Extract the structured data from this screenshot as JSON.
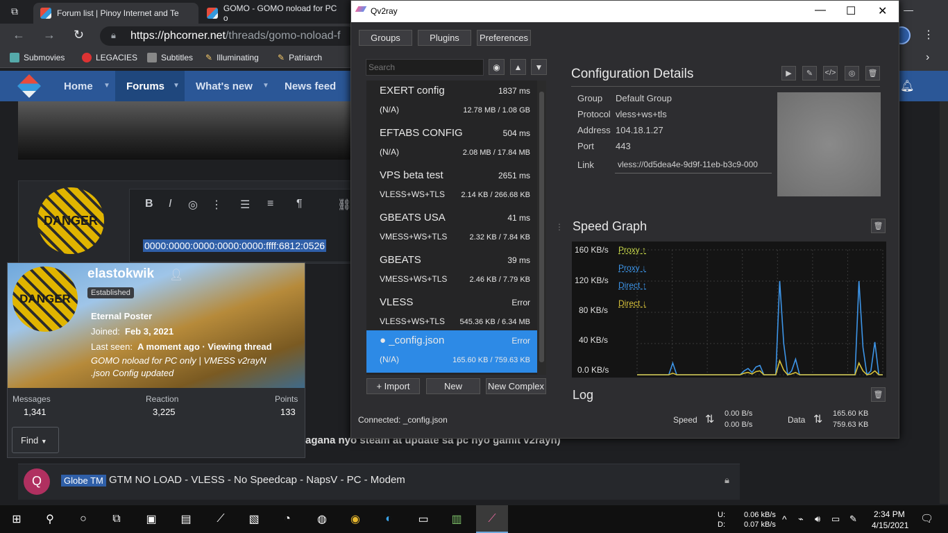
{
  "browser": {
    "tabs": [
      {
        "label": "Forum list | Pinoy Internet and Te"
      },
      {
        "label": "GOMO - GOMO noload for PC o"
      }
    ],
    "url_host": "https://phcorner.net",
    "url_path": "/threads/gomo-noload-f",
    "bookmarks": [
      "Submovies",
      "LEGACIES",
      "Subtitles",
      "Illuminating",
      "Patriarch"
    ]
  },
  "forum": {
    "nav": [
      "Home",
      "Forums",
      "What's new",
      "News feed"
    ],
    "highlighted_text": "0000:0000:0000:0000:0000:ffff:6812:0526",
    "card": {
      "username": "elastokwik",
      "badge": "Established",
      "rank": "Eternal Poster",
      "joined_label": "Joined:",
      "joined_value": "Feb 3, 2021",
      "seen_label": "Last seen:",
      "seen_value": "A moment ago · Viewing thread",
      "viewing_line1": "GOMO noload for PC only | VMESS v2rayN",
      "viewing_line2": ".json Config updated",
      "avatar_text": "DANGER",
      "stats": [
        {
          "label": "Messages",
          "value": "1,341"
        },
        {
          "label": "Reaction",
          "value": "3,225"
        },
        {
          "label": "Points",
          "value": "133"
        }
      ],
      "find": "Find"
    },
    "post_tail": "agana nyo steam at update sa pc nyo gamit v2rayn)",
    "thread": {
      "avatar": "Q",
      "prefix": "Globe TM",
      "title": "GTM NO LOAD - VLESS - No Speedcap - NapsV - PC - Modem"
    }
  },
  "qv2ray": {
    "title": "Qv2ray",
    "top_buttons": [
      "Groups",
      "Plugins",
      "Preferences"
    ],
    "search_placeholder": "Search",
    "connections": [
      {
        "name": "EXERT config",
        "latency": "1837 ms",
        "protocol": "(N/A)",
        "data": "12.78 MB / 1.08 GB"
      },
      {
        "name": "EFTABS CONFIG",
        "latency": "504 ms",
        "protocol": "(N/A)",
        "data": "2.08 MB / 17.84 MB"
      },
      {
        "name": "VPS beta test",
        "latency": "2651 ms",
        "protocol": "VLESS+WS+TLS",
        "data": "2.14 KB / 266.68 KB"
      },
      {
        "name": "GBEATS USA",
        "latency": "41 ms",
        "protocol": "VMESS+WS+TLS",
        "data": "2.32 KB / 7.84 KB"
      },
      {
        "name": "GBEATS",
        "latency": "39 ms",
        "protocol": "VMESS+WS+TLS",
        "data": "2.46 KB / 7.79 KB"
      },
      {
        "name": "VLESS",
        "latency": "Error",
        "protocol": "VLESS+WS+TLS",
        "data": "545.36 KB / 6.34 MB"
      },
      {
        "name": "● _config.json",
        "latency": "Error",
        "protocol": "(N/A)",
        "data": "165.60 KB / 759.63 KB"
      }
    ],
    "bottom_buttons": {
      "import": "+ Import",
      "new": "New",
      "new_complex": "New Complex"
    },
    "connected": "Connected: _config.json",
    "details": {
      "title": "Configuration Details",
      "group_label": "Group",
      "group": "Default Group",
      "protocol_label": "Protocol",
      "protocol": "vless+ws+tls",
      "address_label": "Address",
      "address": "104.18.1.27",
      "port_label": "Port",
      "port": "443",
      "link_label": "Link",
      "link": "vless://0d5dea4e-9d9f-11eb-b3c9-000"
    },
    "speed_graph_title": "Speed Graph",
    "log_title": "Log",
    "speed_label": "Speed",
    "speed_up": "0.00 B/s",
    "speed_down": "0.00 B/s",
    "data_label": "Data",
    "data_up": "165.60 KB",
    "data_down": "759.63 KB",
    "colors": {
      "selected": "#2d8ae6",
      "proxy_up": "#c8d84a",
      "proxy_down": "#3d95e8",
      "direct_up": "#3d95e8",
      "direct_down": "#d8c23a"
    }
  },
  "chart_data": {
    "type": "line",
    "ylim": [
      0,
      160
    ],
    "y_ticks": [
      "160 KB/s",
      "120 KB/s",
      "80 KB/s",
      "40 KB/s",
      "0.0 KB/s"
    ],
    "legend": [
      "Proxy ↑",
      "Proxy ↓",
      "Direct ↑",
      "Direct ↓"
    ],
    "legend_position": "top-left",
    "grid": true,
    "x": [
      0,
      1,
      2,
      3,
      4,
      5,
      6,
      7,
      8,
      9,
      10,
      11,
      12,
      13,
      14,
      15,
      16,
      17,
      18,
      19,
      20,
      21,
      22,
      23,
      24,
      25,
      26,
      27,
      28,
      29,
      30,
      31,
      32,
      33,
      34,
      35,
      36,
      37,
      38,
      39,
      40,
      41,
      42,
      43,
      44,
      45,
      46,
      47,
      48,
      49,
      50,
      51,
      52,
      53,
      54,
      55,
      56,
      57,
      58,
      59
    ],
    "series": [
      {
        "name": "Proxy ↓",
        "values": [
          0,
          0,
          0,
          0,
          0,
          0,
          0,
          0,
          0,
          15,
          0,
          0,
          0,
          0,
          0,
          0,
          0,
          0,
          0,
          0,
          0,
          0,
          0,
          0,
          0,
          0,
          0,
          5,
          8,
          3,
          10,
          12,
          0,
          0,
          0,
          0,
          120,
          40,
          0,
          5,
          20,
          0,
          0,
          0,
          0,
          0,
          0,
          0,
          0,
          0,
          0,
          0,
          0,
          0,
          0,
          0,
          120,
          35,
          0,
          5,
          42,
          0,
          0
        ],
        "color": "#3d95e8"
      },
      {
        "name": "Proxy ↑",
        "values": [
          0,
          0,
          0,
          0,
          0,
          0,
          0,
          0,
          0,
          2,
          0,
          0,
          0,
          0,
          0,
          0,
          0,
          0,
          0,
          0,
          0,
          0,
          0,
          0,
          0,
          0,
          0,
          2,
          3,
          1,
          4,
          5,
          0,
          0,
          0,
          0,
          18,
          6,
          0,
          1,
          3,
          0,
          0,
          0,
          0,
          0,
          0,
          0,
          0,
          0,
          0,
          0,
          0,
          0,
          0,
          0,
          15,
          5,
          0,
          1,
          5,
          0,
          0
        ],
        "color": "#d8c23a"
      }
    ]
  },
  "taskbar": {
    "net_up": "0.06 kB/s",
    "net_down": "0.07 kB/s",
    "ud_u": "U:",
    "ud_d": "D:",
    "time": "2:34 PM",
    "date": "4/15/2021"
  }
}
